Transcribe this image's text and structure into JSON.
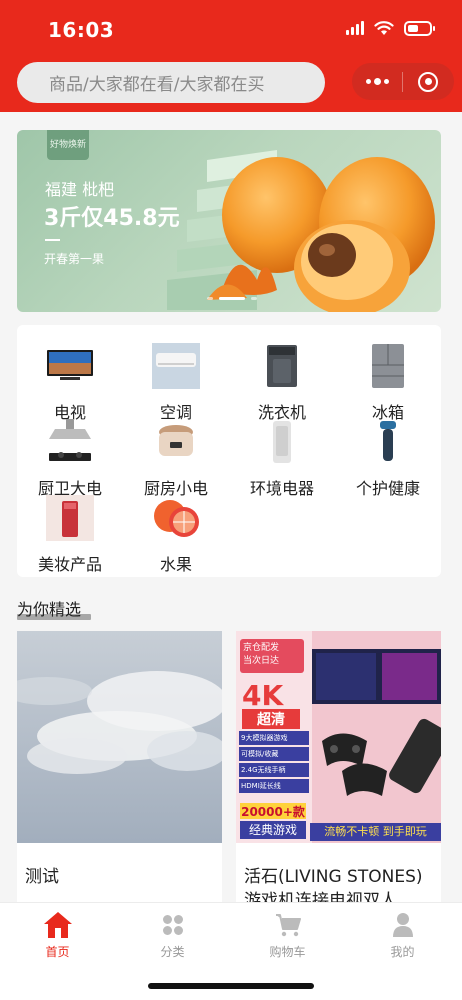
{
  "status_bar": {
    "time": "16:03"
  },
  "search": {
    "placeholder": "商品/大家都在看/大家都在买"
  },
  "banner": {
    "tag": "好物焕新",
    "subtitle": "福建 枇杷",
    "title": "3斤仅45.8元",
    "note": "开春第一果"
  },
  "categories": [
    {
      "label": "电视",
      "icon": "tv-icon"
    },
    {
      "label": "空调",
      "icon": "air-conditioner-icon"
    },
    {
      "label": "洗衣机",
      "icon": "washing-machine-icon"
    },
    {
      "label": "冰箱",
      "icon": "refrigerator-icon"
    },
    {
      "label": "厨卫大电",
      "icon": "range-hood-icon"
    },
    {
      "label": "厨房小电",
      "icon": "rice-cooker-icon"
    },
    {
      "label": "环境电器",
      "icon": "air-purifier-icon"
    },
    {
      "label": "个护健康",
      "icon": "shaver-icon"
    },
    {
      "label": "美妆产品",
      "icon": "cosmetics-icon"
    },
    {
      "label": "水果",
      "icon": "grapefruit-icon"
    }
  ],
  "section": {
    "title": "为你精选"
  },
  "products": [
    {
      "title": "测试"
    },
    {
      "title": "活石(LIVING STONES)游戏机连接电视双人",
      "image_text": {
        "top_badge_line1": "京仓配发",
        "top_badge_line2": "当次日达",
        "resolution": "4K",
        "resolution_sub": "超清",
        "feature1": "9大模拟器游戏",
        "feature2": "可模拟/收藏",
        "feature3": "2.4G无线手柄",
        "feature4": "HDMI延长线",
        "count": "20000+款",
        "count_sub": "经典游戏",
        "slogan": "流畅不卡顿 到手即玩"
      }
    }
  ],
  "tabbar": [
    {
      "label": "首页",
      "icon": "home-icon",
      "active": true
    },
    {
      "label": "分类",
      "icon": "category-icon",
      "active": false
    },
    {
      "label": "购物车",
      "icon": "cart-icon",
      "active": false
    },
    {
      "label": "我的",
      "icon": "user-icon",
      "active": false
    }
  ],
  "colors": {
    "brand": "#e8291c",
    "tab_inactive": "#999999"
  }
}
